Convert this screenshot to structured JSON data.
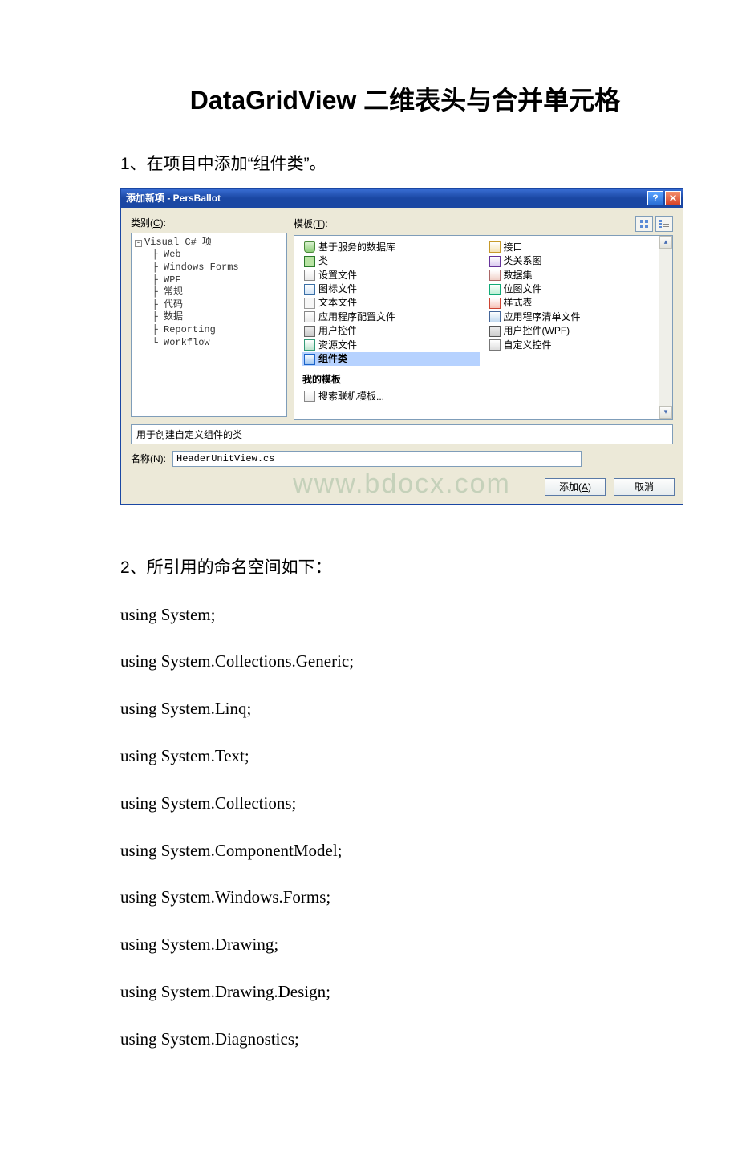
{
  "article": {
    "title": "DataGridView 二维表头与合并单元格",
    "step1": "1、在项目中添加“组件类”。",
    "step2": "2、所引用的命名空间如下：",
    "code_lines": [
      "using System;",
      "using System.Collections.Generic;",
      "using System.Linq;",
      "using System.Text;",
      "using System.Collections;",
      "using System.ComponentModel;",
      "using System.Windows.Forms;",
      "using System.Drawing;",
      "using System.Drawing.Design;",
      "using System.Diagnostics;"
    ]
  },
  "dialog": {
    "title": "添加新项 - PersBallot",
    "help_symbol": "?",
    "close_symbol": "✕",
    "category_label_pre": "类别(",
    "category_label_u": "C",
    "category_label_post": "):",
    "template_label_pre": "模板(",
    "template_label_u": "T",
    "template_label_post": "):",
    "tree": {
      "root": "Visual C# 项",
      "children": [
        "Web",
        "Windows Forms",
        "WPF",
        "常规",
        "代码",
        "数据",
        "Reporting",
        "Workflow"
      ]
    },
    "templates_col1": [
      {
        "icon": "ico-db",
        "label": "基于服务的数据库"
      },
      {
        "icon": "ico-cls",
        "label": "类"
      },
      {
        "icon": "ico-file",
        "label": "设置文件"
      },
      {
        "icon": "ico-icon",
        "label": "图标文件"
      },
      {
        "icon": "ico-txt",
        "label": "文本文件"
      },
      {
        "icon": "ico-file",
        "label": "应用程序配置文件"
      },
      {
        "icon": "ico-ctrl",
        "label": "用户控件"
      },
      {
        "icon": "ico-res",
        "label": "资源文件"
      },
      {
        "icon": "ico-comp",
        "label": "组件类",
        "selected": true
      }
    ],
    "templates_col2": [
      {
        "icon": "ico-iface",
        "label": "接口"
      },
      {
        "icon": "ico-diag",
        "label": "类关系图"
      },
      {
        "icon": "ico-ds",
        "label": "数据集"
      },
      {
        "icon": "ico-bmp",
        "label": "位图文件"
      },
      {
        "icon": "ico-sty",
        "label": "样式表"
      },
      {
        "icon": "ico-man",
        "label": "应用程序清单文件"
      },
      {
        "icon": "ico-wpf",
        "label": "用户控件(WPF)"
      },
      {
        "icon": "ico-cust",
        "label": "自定义控件"
      }
    ],
    "my_templates_heading": "我的模板",
    "search_online": "搜索联机模板...",
    "description": "用于创建自定义组件的类",
    "name_label_pre": "名称(",
    "name_label_u": "N",
    "name_label_post": "):",
    "name_value": "HeaderUnitView.cs",
    "add_pre": "添加(",
    "add_u": "A",
    "add_post": ")",
    "cancel": "取消",
    "watermark": "www.bdocx.com",
    "scroll_up": "▴",
    "scroll_down": "▾"
  }
}
